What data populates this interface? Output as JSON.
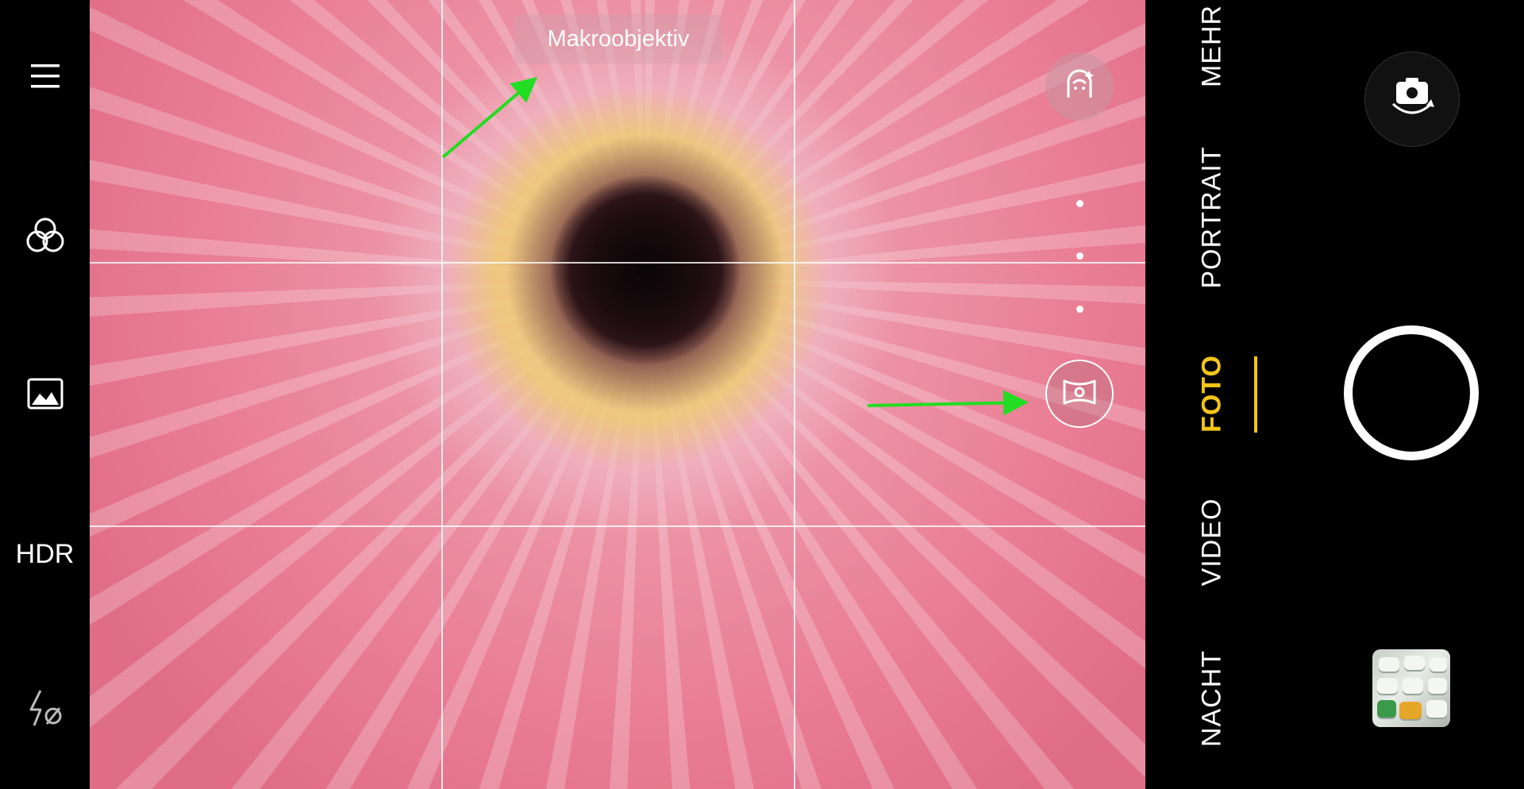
{
  "left_toolbar": {
    "menu_icon": "menu-icon",
    "filter_icon": "filter-circles-icon",
    "image_icon": "image-mode-icon",
    "hdr_label": "HDR",
    "flash_icon": "flash-off-icon"
  },
  "viewfinder": {
    "lens_tooltip": "Makroobjektiv",
    "beauty_icon": "beauty-face-icon",
    "macro_lens_icon": "macro-lens-icon",
    "annotation_arrow_color": "#22dd22"
  },
  "modes": {
    "items": [
      {
        "label": "MEHR",
        "active": false
      },
      {
        "label": "PORTRAIT",
        "active": false
      },
      {
        "label": "FOTO",
        "active": true
      },
      {
        "label": "VIDEO",
        "active": false
      },
      {
        "label": "NACHT",
        "active": false
      }
    ],
    "active_color": "#f5c518"
  },
  "controls": {
    "flip_camera_icon": "flip-camera-icon",
    "shutter_icon": "shutter-button",
    "gallery_icon": "gallery-thumbnail"
  }
}
